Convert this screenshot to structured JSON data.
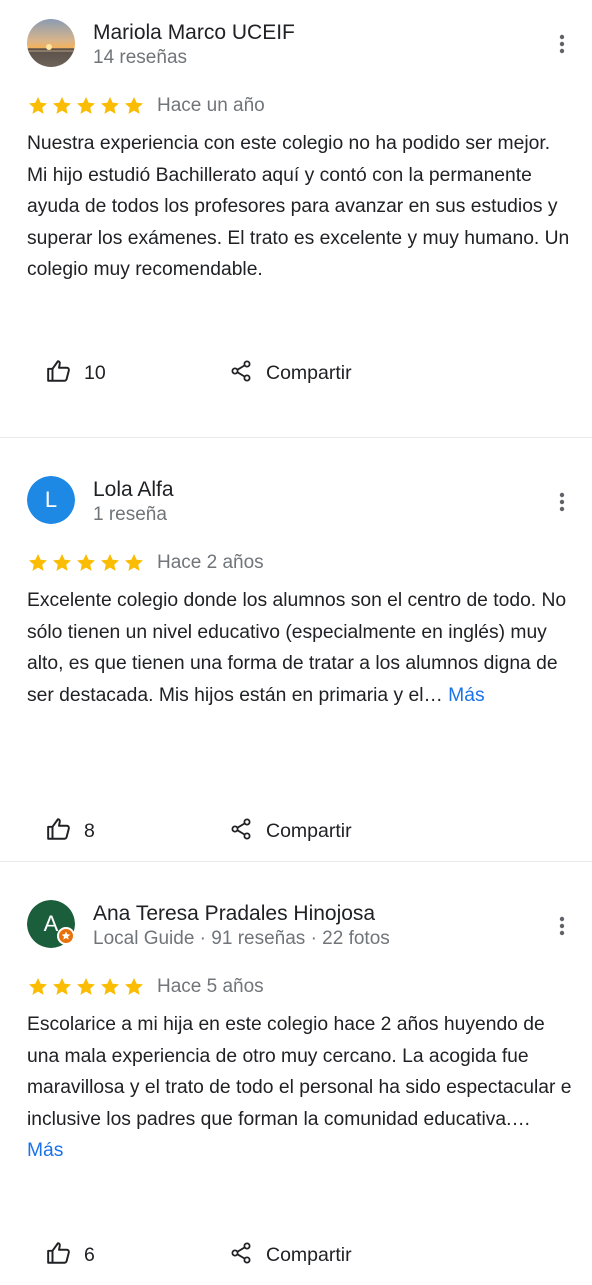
{
  "reviews": [
    {
      "name": "Mariola Marco UCEIF",
      "meta": "14 reseñas",
      "rating": 5,
      "time": "Hace un año",
      "text": "Nuestra experiencia con este colegio no ha podido ser mejor. Mi hijo estudió Bachillerato aquí y contó con la permanente ayuda de todos los profesores para avanzar en sus estudios y superar los exámenes. El trato es excelente y muy humano. Un colegio muy recomendable.",
      "more": "",
      "likes": "10",
      "share": "Compartir",
      "avatar": "photo"
    },
    {
      "name": "Lola Alfa",
      "meta": "1 reseña",
      "rating": 5,
      "time": "Hace 2 años",
      "text": "Excelente colegio donde los alumnos son el centro de todo. No sólo tienen un nivel educativo (especialmente en inglés) muy alto, es que tienen una forma de tratar a los alumnos digna de ser destacada. Mis hijos están en primaria y el… ",
      "more": "Más",
      "likes": "8",
      "share": "Compartir",
      "avatar_letter": "L",
      "avatar_color": "#1e88e5"
    },
    {
      "name": "Ana Teresa Pradales Hinojosa",
      "meta": "Local Guide · 91 reseñas · 22 fotos",
      "rating": 5,
      "time": "Hace 5 años",
      "text": "Escolarice a mi hija en este colegio hace 2 años huyendo de una mala experiencia de otro muy cercano. La acogida fue maravillosa y el trato de todo el personal ha sido espectacular e inclusive los padres que forman la comunidad educativa.… ",
      "more": "Más",
      "likes": "6",
      "share": "Compartir",
      "avatar_letter": "A",
      "avatar_color": "#1b5e3b",
      "local_guide_badge": true
    }
  ],
  "colors": {
    "star": "#fbbc04",
    "link": "#1a73e8",
    "secondary_text": "#70757a",
    "guide_badge": "#e8710a"
  }
}
